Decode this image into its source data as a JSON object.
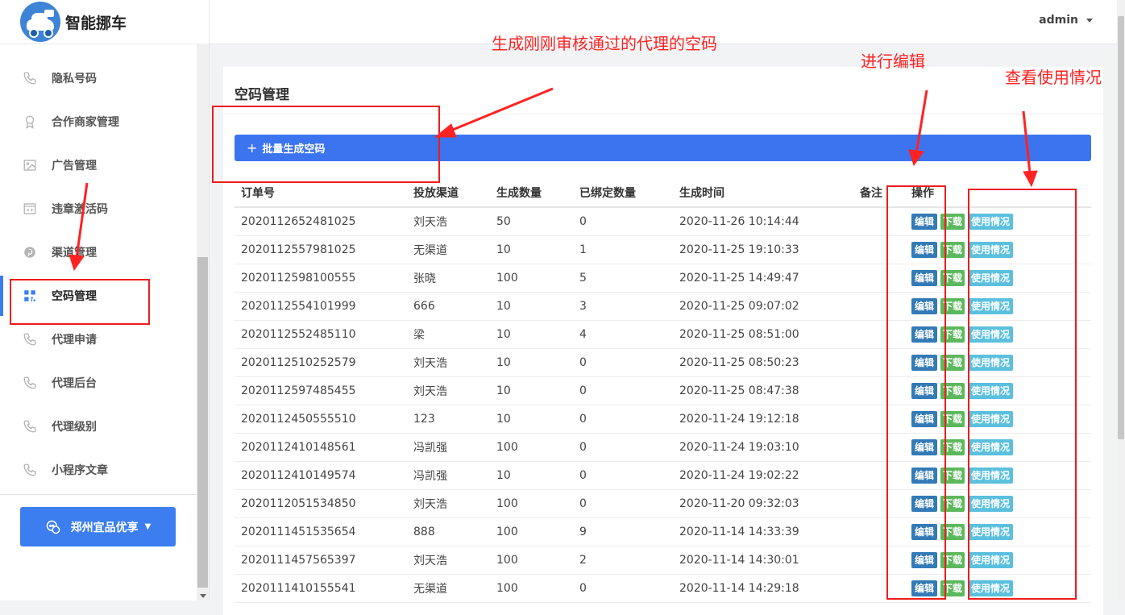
{
  "app": {
    "title": "智能挪车",
    "logo_icon": "car-logo-icon"
  },
  "sidebar": {
    "items": [
      {
        "label": "隐私号码",
        "icon": "phone-icon",
        "active": false
      },
      {
        "label": "合作商家管理",
        "icon": "award-icon",
        "active": false
      },
      {
        "label": "广告管理",
        "icon": "image-icon",
        "active": false
      },
      {
        "label": "违章激活码",
        "icon": "code-icon",
        "active": false
      },
      {
        "label": "渠道管理",
        "icon": "pinterest-icon",
        "active": false
      },
      {
        "label": "空码管理",
        "icon": "qrcode-icon",
        "active": true
      },
      {
        "label": "代理申请",
        "icon": "phone-icon",
        "active": false
      },
      {
        "label": "代理后台",
        "icon": "phone-icon",
        "active": false
      },
      {
        "label": "代理级别",
        "icon": "phone-icon",
        "active": false
      },
      {
        "label": "小程序文章",
        "icon": "phone-icon",
        "active": false
      }
    ],
    "store_button": "郑州宜品优享"
  },
  "header": {
    "username": "admin"
  },
  "page": {
    "title": "空码管理",
    "batch_button": "批量生成空码"
  },
  "table": {
    "columns": [
      "订单号",
      "投放渠道",
      "生成数量",
      "已绑定数量",
      "生成时间",
      "备注",
      "操作"
    ],
    "actions": {
      "edit": "编辑",
      "download": "下载",
      "usage": "使用情况"
    },
    "rows": [
      {
        "order": "2020112652481025",
        "channel": "刘天浩",
        "qty": "50",
        "bound": "0",
        "time": "2020-11-26 10:14:44",
        "note": ""
      },
      {
        "order": "2020112557981025",
        "channel": "无渠道",
        "qty": "10",
        "bound": "1",
        "time": "2020-11-25 19:10:33",
        "note": ""
      },
      {
        "order": "2020112598100555",
        "channel": "张晓",
        "qty": "100",
        "bound": "5",
        "time": "2020-11-25 14:49:47",
        "note": ""
      },
      {
        "order": "2020112554101999",
        "channel": "666",
        "qty": "10",
        "bound": "3",
        "time": "2020-11-25 09:07:02",
        "note": ""
      },
      {
        "order": "2020112552485110",
        "channel": "梁",
        "qty": "10",
        "bound": "4",
        "time": "2020-11-25 08:51:00",
        "note": ""
      },
      {
        "order": "2020112510252579",
        "channel": "刘天浩",
        "qty": "10",
        "bound": "0",
        "time": "2020-11-25 08:50:23",
        "note": ""
      },
      {
        "order": "2020112597485455",
        "channel": "刘天浩",
        "qty": "10",
        "bound": "0",
        "time": "2020-11-25 08:47:38",
        "note": ""
      },
      {
        "order": "2020112450555510",
        "channel": "123",
        "qty": "10",
        "bound": "0",
        "time": "2020-11-24 19:12:18",
        "note": ""
      },
      {
        "order": "2020112410148561",
        "channel": "冯凯强",
        "qty": "100",
        "bound": "0",
        "time": "2020-11-24 19:03:10",
        "note": ""
      },
      {
        "order": "2020112410149574",
        "channel": "冯凯强",
        "qty": "10",
        "bound": "0",
        "time": "2020-11-24 19:02:22",
        "note": ""
      },
      {
        "order": "2020112051534850",
        "channel": "刘天浩",
        "qty": "100",
        "bound": "0",
        "time": "2020-11-20 09:32:03",
        "note": ""
      },
      {
        "order": "2020111451535654",
        "channel": "888",
        "qty": "100",
        "bound": "9",
        "time": "2020-11-14 14:33:39",
        "note": ""
      },
      {
        "order": "2020111457565397",
        "channel": "刘天浩",
        "qty": "100",
        "bound": "2",
        "time": "2020-11-14 14:30:01",
        "note": ""
      },
      {
        "order": "2020111410155541",
        "channel": "无渠道",
        "qty": "100",
        "bound": "0",
        "time": "2020-11-14 14:29:18",
        "note": ""
      }
    ]
  },
  "annotations": {
    "generate_note": "生成刚刚审核通过的代理的空码",
    "edit_note": "进行编辑",
    "usage_note": "查看使用情况",
    "color": "#ff2222"
  },
  "colors": {
    "primary": "#3c74f0",
    "edit": "#337ab7",
    "download": "#5cb85c",
    "usage": "#5bc0de"
  }
}
